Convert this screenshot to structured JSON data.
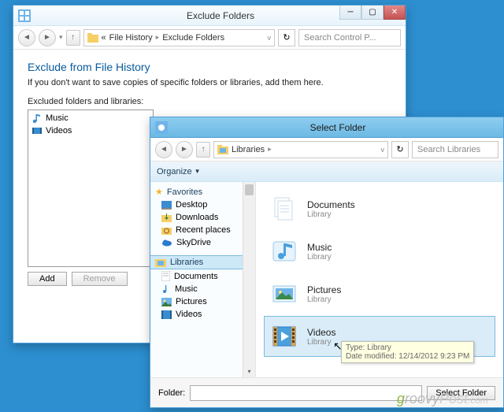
{
  "window1": {
    "title": "Exclude Folders",
    "breadcrumb": {
      "root_hint": "«",
      "part1": "File History",
      "part2": "Exclude Folders"
    },
    "search_placeholder": "Search Control P...",
    "heading": "Exclude from File History",
    "subhead": "If you don't want to save copies of specific folders or libraries, add them here.",
    "list_label": "Excluded folders and libraries:",
    "items": [
      "Music",
      "Videos"
    ],
    "add_label": "Add",
    "remove_label": "Remove"
  },
  "window2": {
    "title": "Select Folder",
    "breadcrumb": {
      "part1": "Libraries"
    },
    "search_placeholder": "Search Libraries",
    "organize": "Organize",
    "sidebar": {
      "favorites": "Favorites",
      "fav_items": [
        "Desktop",
        "Downloads",
        "Recent places",
        "SkyDrive"
      ],
      "libraries": "Libraries",
      "lib_items": [
        "Documents",
        "Music",
        "Pictures",
        "Videos"
      ]
    },
    "content": {
      "items": [
        {
          "name": "Documents",
          "type": "Library"
        },
        {
          "name": "Music",
          "type": "Library"
        },
        {
          "name": "Pictures",
          "type": "Library"
        },
        {
          "name": "Videos",
          "type": "Library"
        }
      ],
      "selected_index": 3
    },
    "tooltip": {
      "line1": "Type: Library",
      "line2": "Date modified: 12/14/2012 9:23 PM"
    },
    "footer": {
      "label": "Folder:",
      "value": "",
      "button": "Select Folder"
    }
  },
  "watermark": "groovyPost.com"
}
